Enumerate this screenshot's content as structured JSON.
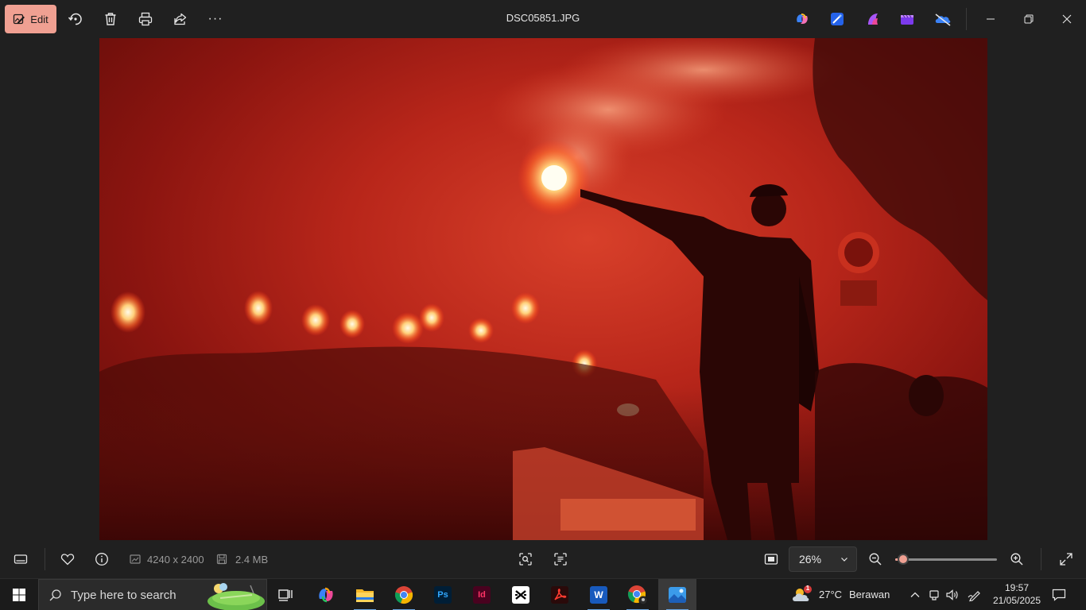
{
  "toolbar": {
    "edit_label": "Edit",
    "title": "DSC05851.JPG",
    "more_label": "···"
  },
  "photo": {
    "description_icon": "photo-viewer-image"
  },
  "bottombar": {
    "dimensions": "4240 x 2400",
    "file_size": "2.4 MB",
    "zoom_value": "26%",
    "zoom_fraction": 0.08
  },
  "taskbar": {
    "search_placeholder": "Type here to search",
    "apps": [
      {
        "name": "Task View"
      },
      {
        "name": "Copilot"
      },
      {
        "name": "File Explorer"
      },
      {
        "name": "Google Chrome"
      },
      {
        "name": "Adobe Photoshop",
        "label": "Ps",
        "color": "#001e36",
        "fg": "#31a8ff"
      },
      {
        "name": "Adobe InDesign",
        "label": "Id",
        "color": "#49021f",
        "fg": "#ff3366"
      },
      {
        "name": "CapCut"
      },
      {
        "name": "Adobe Acrobat"
      },
      {
        "name": "Microsoft Word",
        "label": "W",
        "color": "#185abd",
        "fg": "#ffffff"
      },
      {
        "name": "Chrome Profile"
      },
      {
        "name": "Photos"
      }
    ],
    "weather_temp": "27°C",
    "weather_desc": "Berawan",
    "weather_badge": "1",
    "time": "19:57",
    "date": "21/05/2025"
  },
  "colors": {
    "accent": "#f0a092",
    "bar": "#202020",
    "taskbar": "#1b1b1b"
  }
}
